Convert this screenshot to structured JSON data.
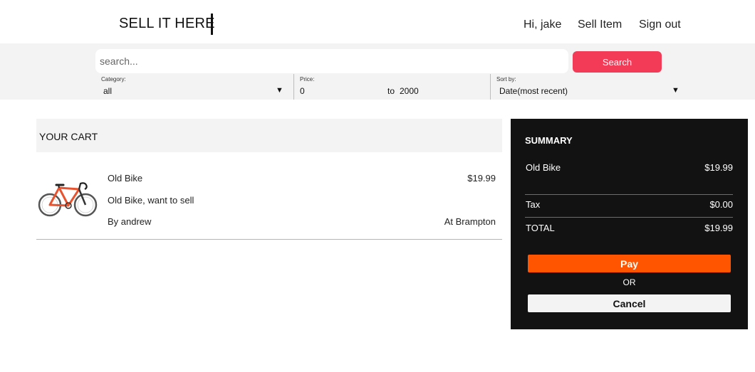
{
  "header": {
    "brand": "SELL IT HERE",
    "greeting": "Hi, jake",
    "sell_item": "Sell Item",
    "sign_out": "Sign out"
  },
  "search": {
    "placeholder": "search...",
    "button_label": "Search"
  },
  "filters": {
    "category": {
      "label": "Category:",
      "value": "all"
    },
    "price": {
      "label": "Price:",
      "min": "0",
      "separator": "to",
      "max": "2000"
    },
    "sort": {
      "label": "Sort by:",
      "value": "Date(most recent)"
    }
  },
  "cart": {
    "title": "YOUR CART",
    "items": [
      {
        "name": "Old Bike",
        "description": "Old Bike, want to sell",
        "seller": "By andrew",
        "price": "$19.99",
        "location": "At Brampton",
        "image_icon": "road-bike-image"
      }
    ]
  },
  "summary": {
    "title": "SUMMARY",
    "lines": [
      {
        "label": "Old Bike",
        "value": "$19.99"
      }
    ],
    "tax": {
      "label": "Tax",
      "value": "$0.00"
    },
    "total": {
      "label": "TOTAL",
      "value": "$19.99"
    },
    "pay_label": "Pay",
    "or_label": "OR",
    "cancel_label": "Cancel"
  },
  "colors": {
    "search_button": "#f33b57",
    "pay_button": "#ff5500",
    "summary_bg": "#121212"
  }
}
